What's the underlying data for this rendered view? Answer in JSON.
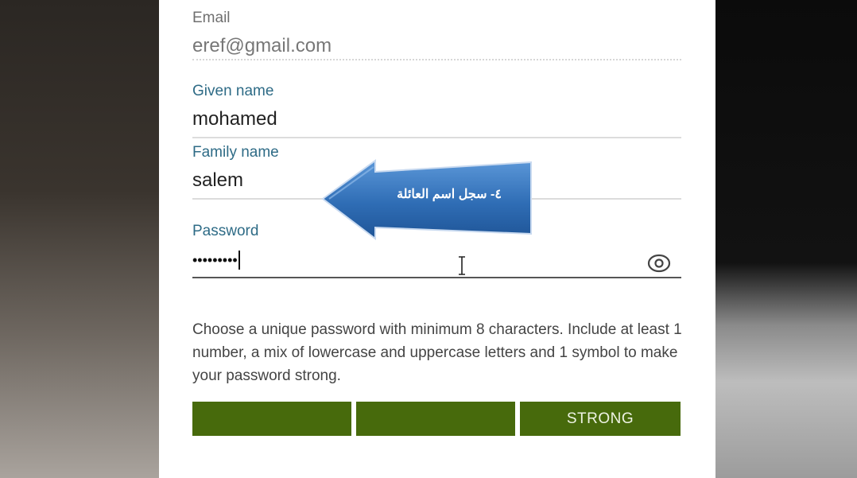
{
  "form": {
    "email": {
      "label": "Email",
      "value": "eref@gmail.com"
    },
    "given_name": {
      "label": "Given name",
      "value": "mohamed"
    },
    "family_name": {
      "label": "Family name",
      "value": "salem"
    },
    "password": {
      "label": "Password",
      "masked_value": "•••••••••",
      "toggle_icon": "eye-icon"
    }
  },
  "password_hint": "Choose a unique password with minimum 8 characters. Include at least 1 number, a mix of lowercase and uppercase letters and 1 symbol to make your password strong.",
  "strength_meter": {
    "label": "STRONG",
    "segments": 3,
    "filled": 3,
    "color": "#476a0c"
  },
  "annotation": {
    "text": "٤- سجل اسم العائلة",
    "color": "#3c78c2"
  }
}
